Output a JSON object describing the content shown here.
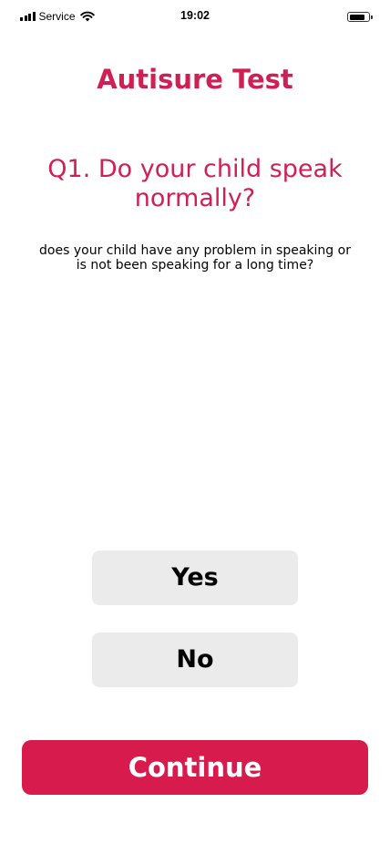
{
  "status_bar": {
    "carrier": "Service",
    "time": "19:02"
  },
  "header": {
    "title": "Autisure Test"
  },
  "question": {
    "text": "Q1. Do your child speak normally?",
    "description": "does your child have any problem in speaking or is not been speaking for a long time?"
  },
  "options": [
    {
      "label": "Yes"
    },
    {
      "label": "No"
    }
  ],
  "footer": {
    "continue_label": "Continue"
  },
  "colors": {
    "accent": "#cf1f55",
    "button_primary": "#d81b4d",
    "option_background": "#ebebeb"
  }
}
